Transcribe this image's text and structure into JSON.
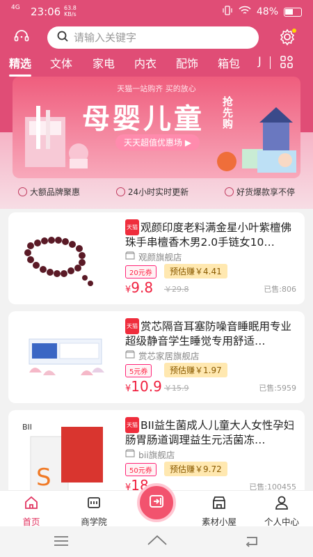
{
  "status_bar": {
    "signal": "4G",
    "time": "23:06",
    "speed_value": "63.8",
    "speed_unit": "KB/s",
    "battery": "48%"
  },
  "search": {
    "placeholder": "请输入关键字"
  },
  "tabs": [
    "精选",
    "文体",
    "家电",
    "内衣",
    "配饰",
    "箱包",
    "J"
  ],
  "banner": {
    "subtitle": "天猫一站购齐 买的放心",
    "headline": "母婴儿童",
    "side_text": "抢先购",
    "pill": "天天超值优惠场"
  },
  "features": [
    "大额品牌聚惠",
    "24小时实时更新",
    "好货爆款享不停"
  ],
  "products": [
    {
      "title": "观颜印度老料满金星小叶紫檀佛珠手串檀香木男2.0手链女10…",
      "shop": "观颜旗舰店",
      "coupon": "20元券",
      "earn": "预估赚￥4.41",
      "price_symbol": "¥",
      "price": "9.8",
      "orig": "￥29.8",
      "sold": "已售:806"
    },
    {
      "title": "赏芯隔音耳塞防噪音睡眠用专业超级静音学生睡觉专用舒适…",
      "shop": "赏芯家居旗舰店",
      "coupon": "5元券",
      "earn": "预估赚￥1.97",
      "price_symbol": "¥",
      "price": "10.9",
      "orig": "￥15.9",
      "sold": "已售:5959"
    },
    {
      "title": "BII益生菌成人儿童大人女性孕妇肠胃肠道调理益生元活菌冻…",
      "shop": "bii旗舰店",
      "coupon": "50元券",
      "earn": "预估赚￥9.72",
      "price_symbol": "¥",
      "price": "18",
      "orig": "",
      "sold": "已售:100455"
    }
  ],
  "product_badge": "天猫",
  "nav": [
    "首页",
    "商学院",
    "素材小屋",
    "个人中心"
  ],
  "colors": {
    "brand": "#e04d76",
    "price": "#f01f3e"
  }
}
